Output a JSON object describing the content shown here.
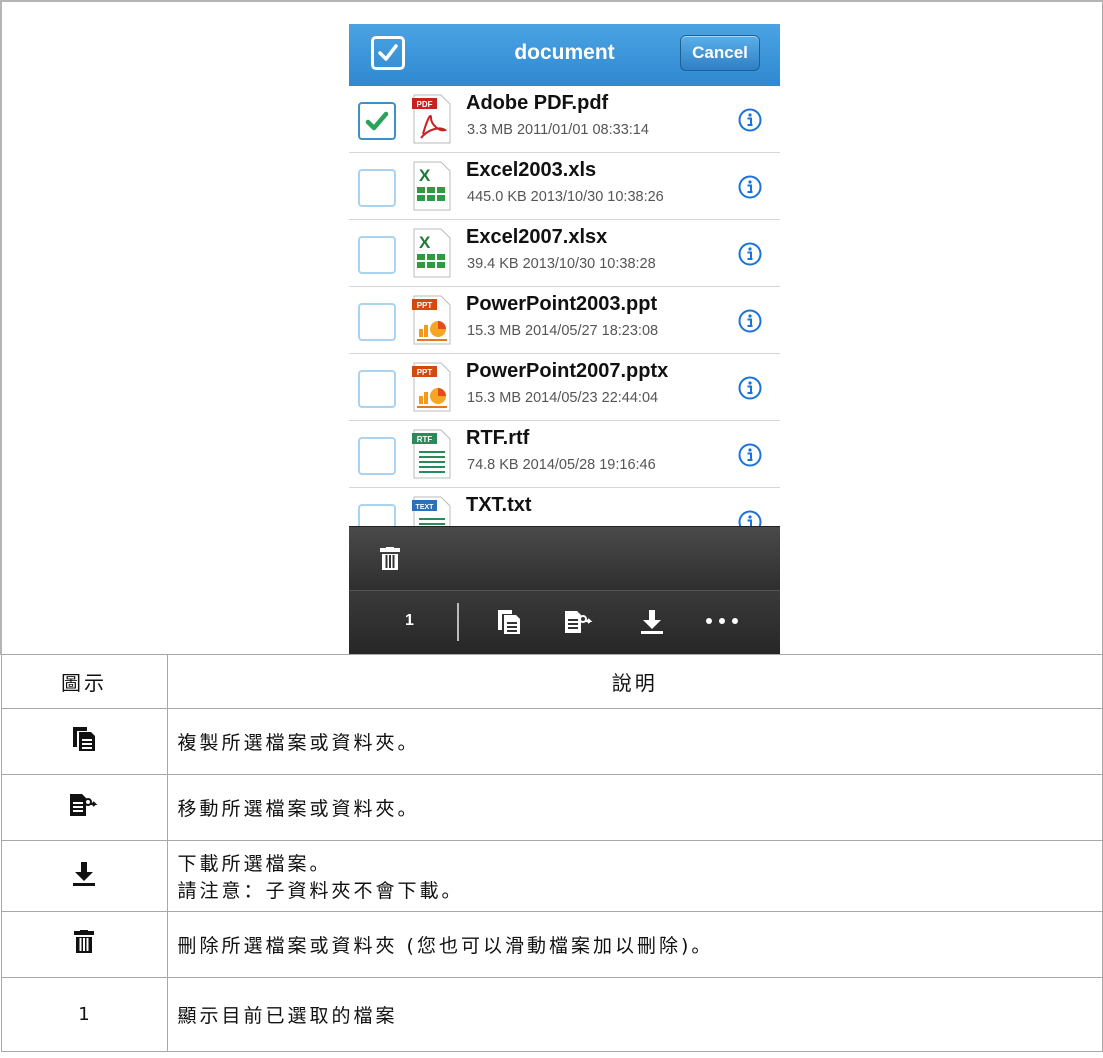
{
  "phone": {
    "title": "document",
    "cancel_label": "Cancel",
    "files": [
      {
        "name": "Adobe PDF.pdf",
        "meta": "3.3 MB 2011/01/01 08:33:14",
        "type": "pdf",
        "selected": true
      },
      {
        "name": "Excel2003.xls",
        "meta": "445.0 KB 2013/10/30 10:38:26",
        "type": "excel",
        "selected": false
      },
      {
        "name": "Excel2007.xlsx",
        "meta": "39.4 KB 2013/10/30 10:38:28",
        "type": "excel",
        "selected": false
      },
      {
        "name": "PowerPoint2003.ppt",
        "meta": "15.3 MB 2014/05/27 18:23:08",
        "type": "ppt",
        "selected": false
      },
      {
        "name": "PowerPoint2007.pptx",
        "meta": "15.3 MB 2014/05/23 22:44:04",
        "type": "ppt",
        "selected": false
      },
      {
        "name": "RTF.rtf",
        "meta": "74.8 KB 2014/05/28 19:16:46",
        "type": "rtf",
        "selected": false
      },
      {
        "name": "TXT.txt",
        "meta": "",
        "type": "txt",
        "selected": false
      }
    ],
    "icon_labels": {
      "pdf": "PDF",
      "ppt": "PPT",
      "rtf": "RTF",
      "txt": "TEXT",
      "excel": "X"
    },
    "toolbar": {
      "selected_count": "1",
      "icons": [
        "trash-icon",
        "copy-icon",
        "move-icon",
        "download-icon",
        "more-icon"
      ]
    }
  },
  "table": {
    "header_icon": "圖示",
    "header_desc": "說明",
    "rows": [
      {
        "icon": "copy-icon",
        "desc": "複製所選檔案或資料夾。"
      },
      {
        "icon": "move-icon",
        "desc": "移動所選檔案或資料夾。"
      },
      {
        "icon": "download-icon",
        "desc": "下載所選檔案。",
        "desc2": "請注意：子資料夾不會下載。"
      },
      {
        "icon": "trash-icon",
        "desc": "刪除所選檔案或資料夾 (您也可以滑動檔案加以刪除)。"
      },
      {
        "icon_text": "1",
        "desc": "顯示目前已選取的檔案"
      }
    ]
  },
  "colors": {
    "nav_blue": "#3a96da",
    "check_green": "#29a35a",
    "info_blue": "#1a73d8"
  }
}
